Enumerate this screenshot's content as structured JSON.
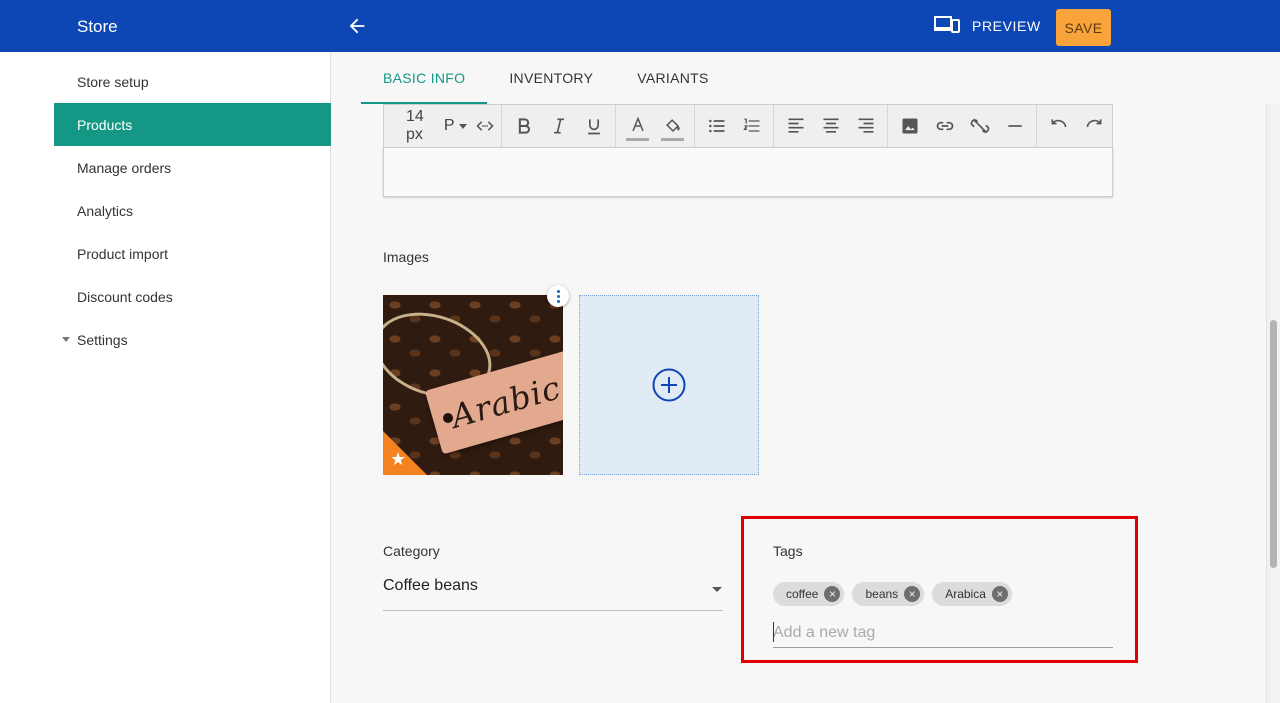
{
  "header": {
    "title": "Store",
    "preview_label": "PREVIEW",
    "save_label": "SAVE"
  },
  "sidebar": {
    "items": [
      {
        "label": "Store setup"
      },
      {
        "label": "Products"
      },
      {
        "label": "Manage orders"
      },
      {
        "label": "Analytics"
      },
      {
        "label": "Product import"
      },
      {
        "label": "Discount codes"
      },
      {
        "label": "Settings"
      }
    ]
  },
  "tabs": [
    {
      "label": "BASIC INFO"
    },
    {
      "label": "INVENTORY"
    },
    {
      "label": "VARIANTS"
    }
  ],
  "editor": {
    "font_size": "14 px",
    "paragraph": "P"
  },
  "images": {
    "label": "Images",
    "image_text": "Arabic"
  },
  "category": {
    "label": "Category",
    "value": "Coffee beans"
  },
  "tags": {
    "label": "Tags",
    "items": [
      {
        "label": "coffee"
      },
      {
        "label": "beans"
      },
      {
        "label": "Arabica"
      }
    ],
    "input_placeholder": "Add a new tag"
  },
  "colors": {
    "header": "#0d47b5",
    "accent": "#149784",
    "save": "#f9a33b",
    "highlight": "#e10000"
  }
}
